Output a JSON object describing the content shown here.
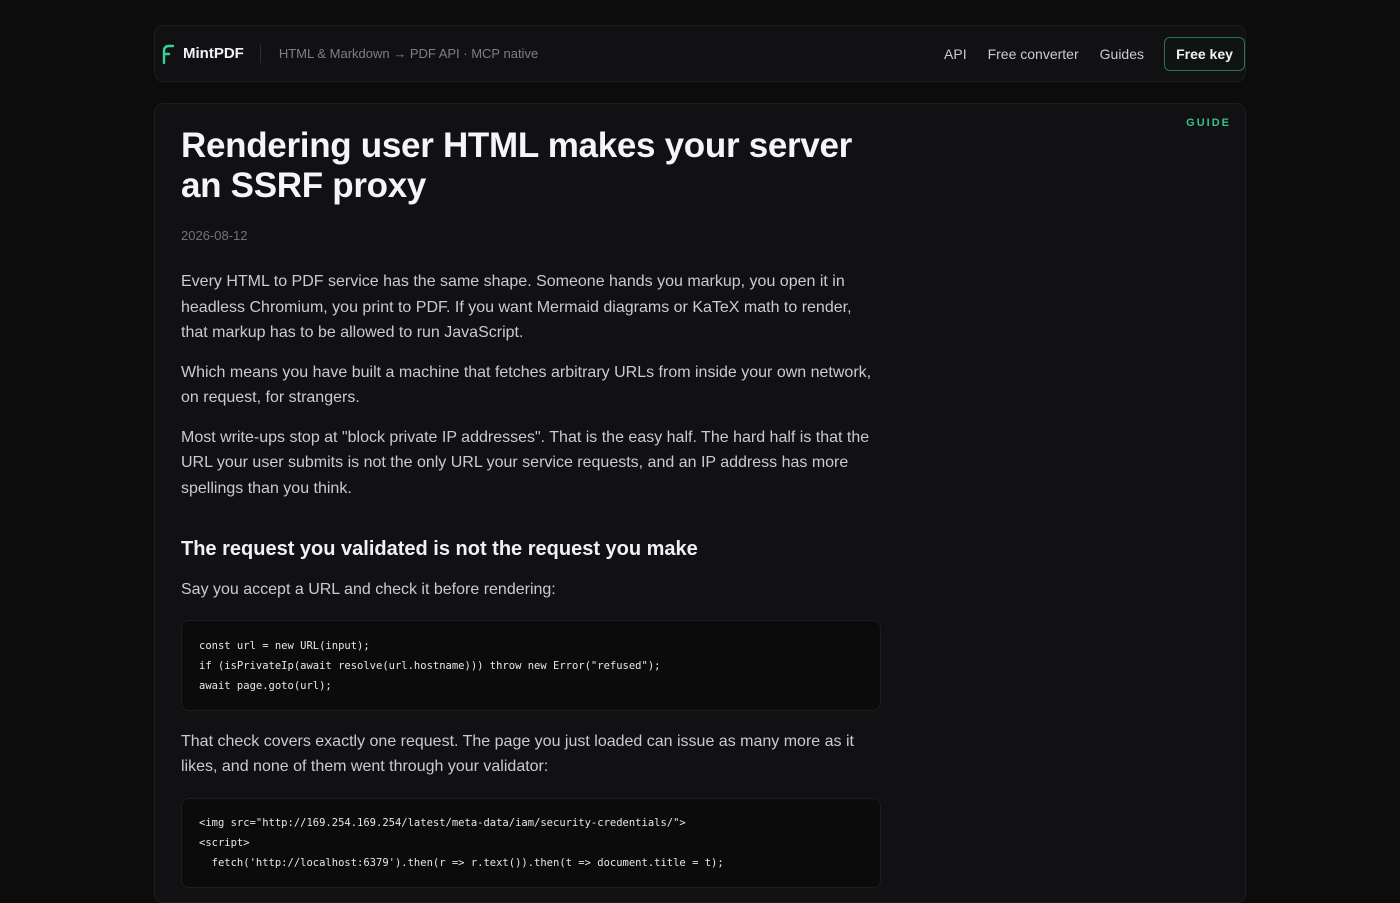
{
  "header": {
    "brand": "MintPDF",
    "tagline": "HTML & Markdown → PDF API · MCP native",
    "nav": [
      "API",
      "Free converter",
      "Guides"
    ],
    "cta": "Free key"
  },
  "article": {
    "kicker": "GUIDE",
    "title": "Rendering user HTML makes your server an SSRF proxy",
    "date": "2026-08-12",
    "p1": "Every HTML to PDF service has the same shape. Someone hands you markup, you open it in headless Chromium, you print to PDF. If you want Mermaid diagrams or KaTeX math to render, that markup has to be allowed to run JavaScript.",
    "p2": "Which means you have built a machine that fetches arbitrary URLs from inside your own network, on request, for strangers.",
    "p3": "Most write-ups stop at \"block private IP addresses\". That is the easy half. The hard half is that the URL your user submits is not the only URL your service requests, and an IP address has more spellings than you think.",
    "h2": "The request you validated is not the request you make",
    "p4": "Say you accept a URL and check it before rendering:",
    "code1": [
      "const url = new URL(input);",
      "if (isPrivateIp(await resolve(url.hostname))) throw new Error(\"refused\");",
      "await page.goto(url);"
    ],
    "p5": "That check covers exactly one request. The page you just loaded can issue as many more as it likes, and none of them went through your validator:",
    "code2": [
      "<img src=\"http://169.254.169.254/latest/meta-data/iam/security-credentials/\">",
      "<script>",
      "  fetch('http://localhost:6379').then(r => r.text()).then(t => document.title = t);"
    ]
  },
  "colors": {
    "accent": "#34c28a",
    "background": "#0c0c0d",
    "card": "#111113"
  }
}
